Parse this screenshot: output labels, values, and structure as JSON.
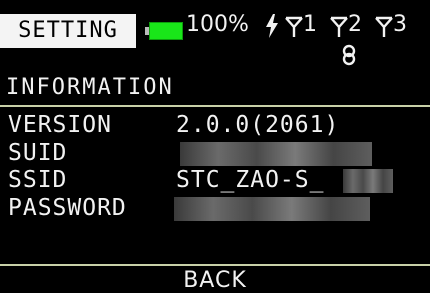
{
  "header": {
    "mode": "SETTING",
    "battery_percent": "100%",
    "battery_level": 1.0,
    "charging_icon": "bolt-icon",
    "antennas": [
      "1",
      "2",
      "3"
    ],
    "link_icon": "link-icon"
  },
  "section": {
    "title": "INFORMATION"
  },
  "info": {
    "version_label": "VERSION",
    "version_value": "2.0.0(2061)",
    "suid_label": "SUID",
    "ssid_label": "SSID",
    "ssid_value": "STC_ZAO-S_",
    "password_label": "PASSWORD"
  },
  "footer": {
    "back": "BACK"
  },
  "colors": {
    "accent_rule": "#c8d0a8",
    "battery": "#19e619",
    "background": "#000000"
  }
}
